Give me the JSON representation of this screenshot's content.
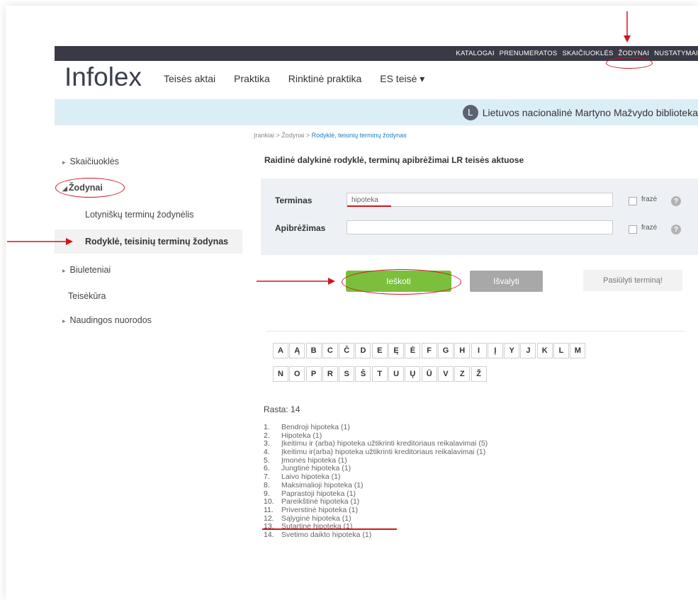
{
  "topnav": {
    "items": [
      "KATALOGAI",
      "PRENUMERATOS",
      "SKAIČIUOKLĖS",
      "ŽODYNAI",
      "NUSTATYMAI"
    ]
  },
  "header": {
    "logo": "Infolex",
    "nav": [
      "Teisės aktai",
      "Praktika",
      "Rinktinė praktika",
      "ES teisė ▾"
    ]
  },
  "library": {
    "badge": "L",
    "name": "Lietuvos nacionalinė Martyno Mažvydo biblioteka"
  },
  "sidebar": {
    "items": [
      {
        "label": "Skaičiuoklės",
        "prefix": "▸"
      },
      {
        "label": "Žodynai",
        "prefix": "◢"
      },
      {
        "label": "Lotyniškų terminų žodynėlis",
        "prefix": ""
      },
      {
        "label": "Rodyklė, teisinių terminų žodynas",
        "prefix": ""
      },
      {
        "label": "Biuleteniai",
        "prefix": "▸"
      },
      {
        "label": "Teisėkūra",
        "prefix": ""
      },
      {
        "label": "Naudingos nuorodos",
        "prefix": "▸"
      }
    ]
  },
  "breadcrumb": {
    "part1": "Įrankiai",
    "part2": "Žodynai",
    "current": "Rodyklė, teisinių terminų žodynas",
    "sep": ">"
  },
  "page": {
    "title": "Raidinė dalykinė rodyklė, terminų apibrėžimai LR teisės aktuose"
  },
  "form": {
    "term_label": "Terminas",
    "term_value": "hipoteka",
    "def_label": "Apibrėžimas",
    "def_value": "",
    "phrase_label": "frazė",
    "help": "?"
  },
  "buttons": {
    "search": "Ieškoti",
    "clear": "Išvalyti",
    "suggest": "Pasiūlyti terminą!"
  },
  "alphabet": {
    "row1": [
      "A",
      "Ą",
      "B",
      "C",
      "Č",
      "D",
      "E",
      "Ę",
      "Ė",
      "F",
      "G",
      "H",
      "I",
      "Į",
      "Y",
      "J",
      "K",
      "L",
      "M"
    ],
    "row2": [
      "N",
      "O",
      "P",
      "R",
      "S",
      "Š",
      "T",
      "U",
      "Ų",
      "Ū",
      "V",
      "Z",
      "Ž"
    ]
  },
  "results": {
    "found_label": "Rasta: 14",
    "items": [
      {
        "num": "1.",
        "text": "Bendroji hipoteka (1)"
      },
      {
        "num": "2.",
        "text": "Hipoteka (1)"
      },
      {
        "num": "3.",
        "text": "Įkeitimu ir (arba) hipoteka užtikrinti kreditoriaus reikalavimai (5)"
      },
      {
        "num": "4.",
        "text": "Įkeitimu ir(arba) hipoteka užtikrinti kreditoriaus reikalavimai (1)"
      },
      {
        "num": "5.",
        "text": "Įmonės hipoteka (1)"
      },
      {
        "num": "6.",
        "text": "Jungtinė hipoteka (1)"
      },
      {
        "num": "7.",
        "text": "Laivo hipoteka (1)"
      },
      {
        "num": "8.",
        "text": "Maksimalioji hipoteka (1)"
      },
      {
        "num": "9.",
        "text": "Paprastoji hipoteka (1)"
      },
      {
        "num": "10.",
        "text": "Pareikštinė hipoteka (1)"
      },
      {
        "num": "11.",
        "text": "Priverstinė hipoteka (1)"
      },
      {
        "num": "12.",
        "text": "Sąlyginė hipoteka (1)"
      },
      {
        "num": "13.",
        "text": "Sutartinė hipoteka (1)"
      },
      {
        "num": "14.",
        "text": "Svetimo daikto hipoteka (1)"
      }
    ]
  },
  "colors": {
    "topbar": "#3a3a46",
    "bluebar": "#dceef5",
    "search_button": "#7bbf3c",
    "clear_button": "#a8a8a8",
    "annotation": "#d2141b",
    "link": "#1a7fc4"
  }
}
